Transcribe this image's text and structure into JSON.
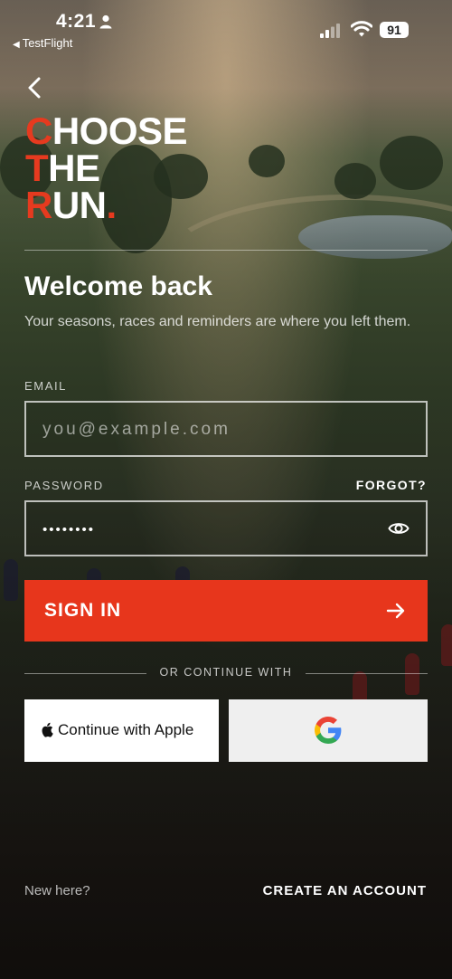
{
  "status_bar": {
    "time": "4:21",
    "back_app": "TestFlight",
    "battery": "91",
    "icons": [
      "person-icon",
      "signal-icon",
      "wifi-icon",
      "battery-icon"
    ]
  },
  "logo": {
    "line1_initial": "C",
    "line1_rest": "HOOSE",
    "line2_initial": "T",
    "line2_rest": "HE",
    "line3_initial": "R",
    "line3_rest": "UN",
    "period": "."
  },
  "header": {
    "title": "Welcome back",
    "subtitle": "Your seasons, races and reminders are where you left them."
  },
  "form": {
    "email_label": "EMAIL",
    "email_placeholder": "you@example.com",
    "email_value": "",
    "password_label": "PASSWORD",
    "password_value": "••••••••",
    "forgot_label": "FORGOT?",
    "sign_in_label": "SIGN IN",
    "divider_text": "OR CONTINUE WITH",
    "apple_label": "Continue with Apple",
    "google_icon": "google-g-icon"
  },
  "footer": {
    "new_here": "New here?",
    "create_account": "CREATE AN ACCOUNT"
  },
  "colors": {
    "accent": "#e7361c",
    "logo_red": "#e63a1f"
  }
}
